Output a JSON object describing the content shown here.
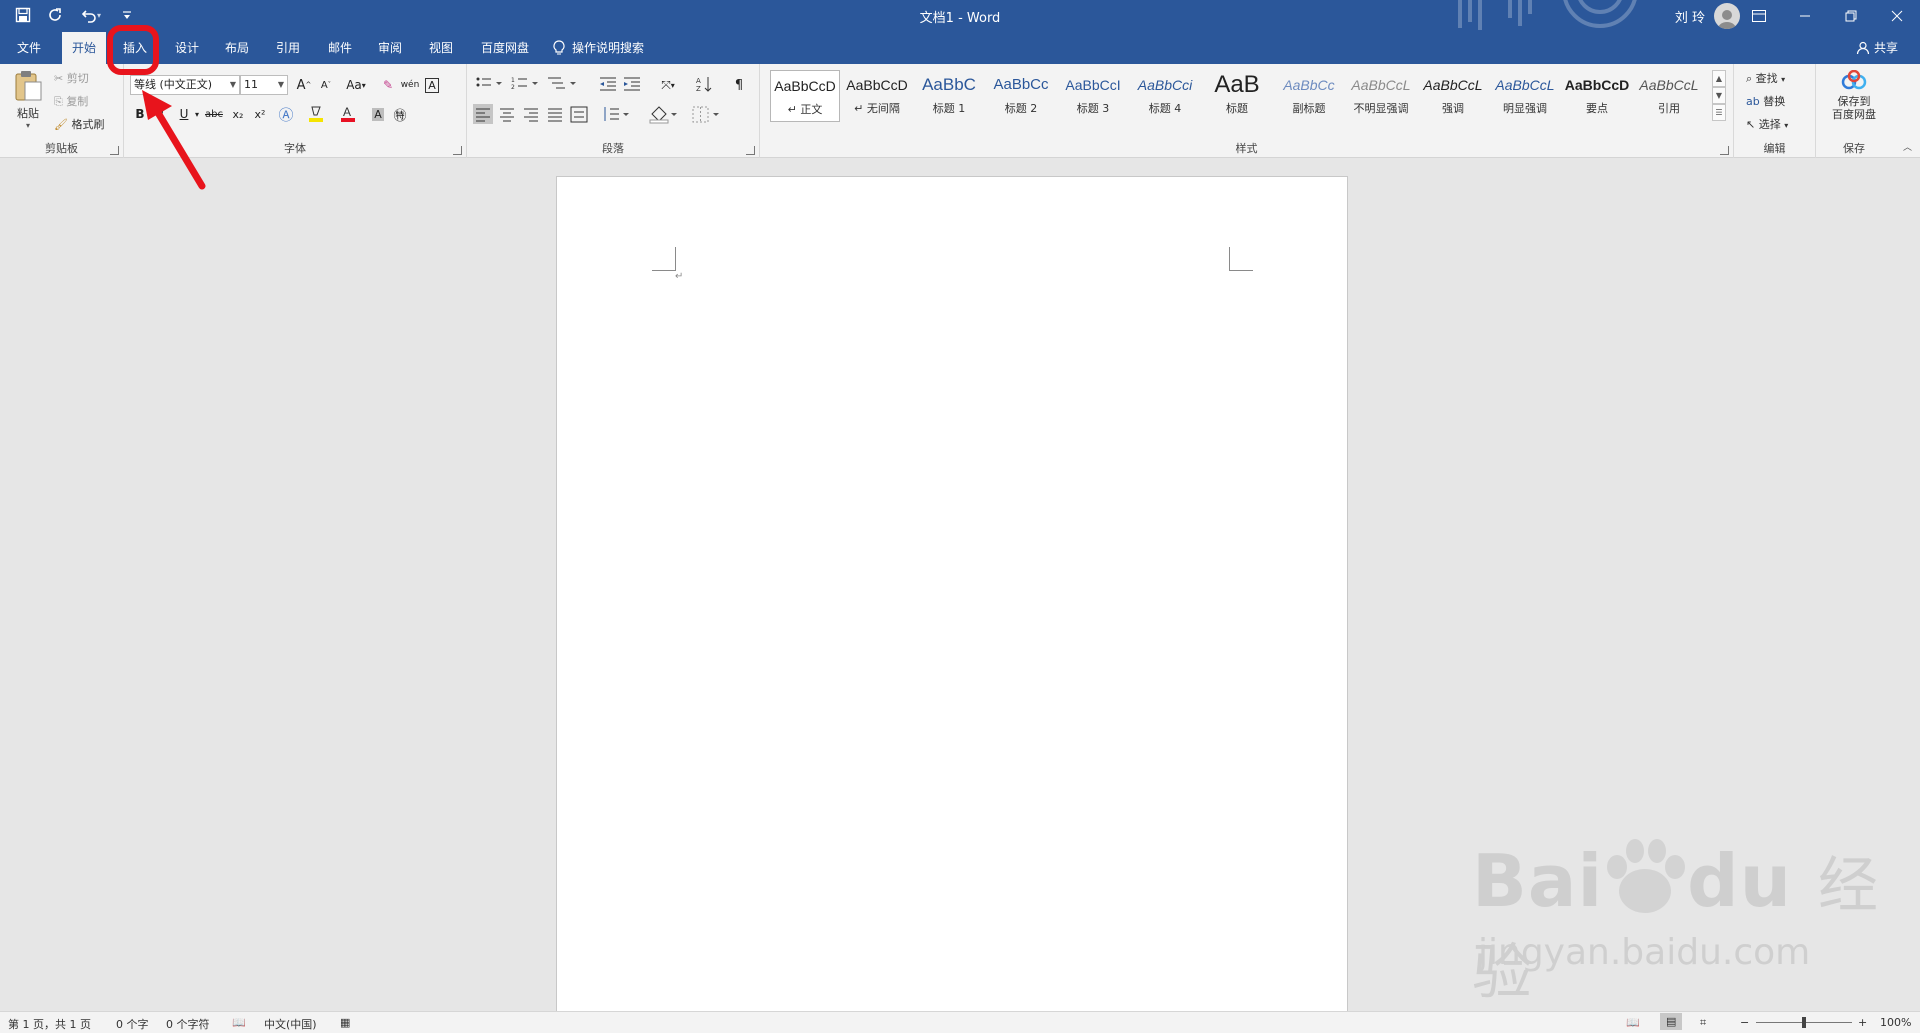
{
  "window": {
    "title": "文档1  -  Word",
    "user": "刘 玲"
  },
  "icons": {
    "save": "save-icon",
    "autosave": "refresh-icon",
    "undo": "undo-icon",
    "customize": "customize-qat-icon",
    "minimize": "minimize-icon",
    "restore": "restore-icon",
    "close": "close-icon",
    "ribbon_display": "ribbon-display-options-icon"
  },
  "tabs": [
    {
      "label": "文件"
    },
    {
      "label": "开始"
    },
    {
      "label": "插入"
    },
    {
      "label": "设计"
    },
    {
      "label": "布局"
    },
    {
      "label": "引用"
    },
    {
      "label": "邮件"
    },
    {
      "label": "审阅"
    },
    {
      "label": "视图"
    },
    {
      "label": "百度网盘"
    }
  ],
  "tell_me": "操作说明搜索",
  "share": "共享",
  "clipboard": {
    "paste": "粘贴",
    "cut": "剪切",
    "copy": "复制",
    "format_painter": "格式刷",
    "label": "剪贴板"
  },
  "font": {
    "name": "等线 (中文正文)",
    "size": "11",
    "label": "字体",
    "grow": "A",
    "shrink": "A",
    "case": "Aa",
    "phonetic": "wén",
    "bold": "B",
    "italic": "I",
    "underline": "U",
    "strike": "abc",
    "subscript": "x₂",
    "superscript": "x²"
  },
  "paragraph": {
    "label": "段落"
  },
  "styles": {
    "label": "样式",
    "items": [
      {
        "sample": "AaBbCcD",
        "name": "↵ 正文"
      },
      {
        "sample": "AaBbCcD",
        "name": "↵ 无间隔"
      },
      {
        "sample": "AaBbC",
        "name": "标题 1"
      },
      {
        "sample": "AaBbCc",
        "name": "标题 2"
      },
      {
        "sample": "AaBbCcI",
        "name": "标题 3"
      },
      {
        "sample": "AaBbCci",
        "name": "标题 4"
      },
      {
        "sample": "AaB",
        "name": "标题"
      },
      {
        "sample": "AaBbCc",
        "name": "副标题"
      },
      {
        "sample": "AaBbCcL",
        "name": "不明显强调"
      },
      {
        "sample": "AaBbCcL",
        "name": "强调"
      },
      {
        "sample": "AaBbCcL",
        "name": "明显强调"
      },
      {
        "sample": "AaBbCcD",
        "name": "要点"
      },
      {
        "sample": "AaBbCcL",
        "name": "引用"
      }
    ]
  },
  "editing": {
    "find": "查找",
    "replace": "替换",
    "select": "选择",
    "label": "编辑"
  },
  "save_group": {
    "button": [
      "保存到",
      "百度网盘"
    ],
    "label": "保存"
  },
  "status": {
    "page": "第 1 页，共 1 页",
    "words": "0 个字",
    "chars": "0 个字符",
    "language": "中文(中国)",
    "zoom": "100%"
  },
  "watermark": {
    "brand": "Bai",
    "brand2": "du",
    "cn": "经验",
    "url": "jingyan.baidu.com"
  },
  "paragraph_mark": "↵",
  "colors": {
    "accent": "#2b579a",
    "annotation": "#e8141c",
    "highlight": "#f5e400",
    "font_color": "#e81123"
  }
}
